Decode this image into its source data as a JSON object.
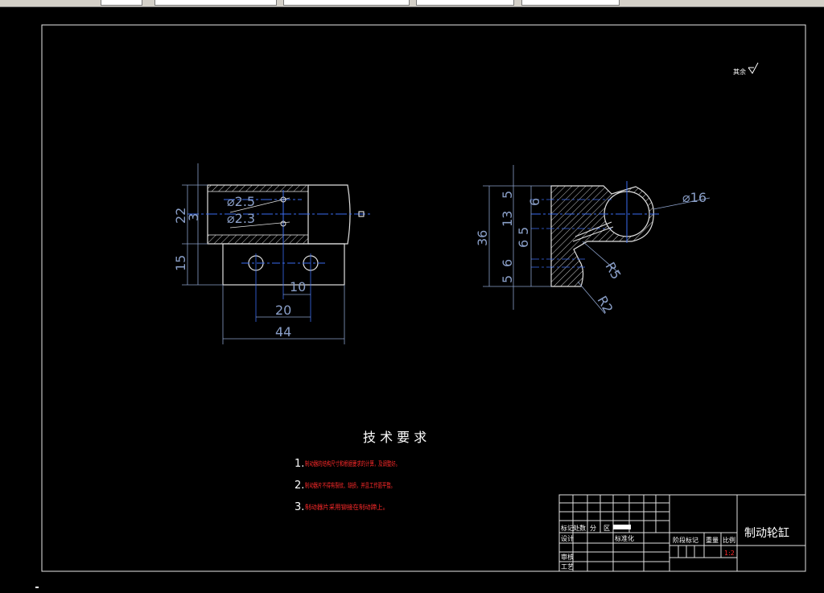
{
  "drawing": {
    "left_view": {
      "dims": {
        "d25": "⌀2.5",
        "d23": "⌀2.3",
        "h22": "22",
        "h3": "3",
        "h15": "15",
        "w10": "10",
        "w20": "20",
        "w44": "44"
      }
    },
    "right_view": {
      "dims": {
        "d16": "⌀16",
        "v5a": "5",
        "v6a": "6",
        "v13": "13",
        "v5b": "5",
        "v36": "36",
        "v6b": "6",
        "v6c": "6",
        "v5c": "5",
        "r5": "R5",
        "r2": "R2"
      }
    },
    "surface_finish": "其余"
  },
  "tech_req": {
    "title": "技 术 要 求",
    "items": [
      {
        "num": "1.",
        "text": "制动器的结构尺寸和根据要求的计算，及调整好。"
      },
      {
        "num": "2.",
        "text": "制动器片不得有裂纹、缺损，并且工作面平整。"
      },
      {
        "num": "3.",
        "text": "制动器片采用铆接在制动蹄上。"
      }
    ]
  },
  "title_block": {
    "part_name": "制动轮缸",
    "scale_value": "1:2",
    "labels": {
      "mark": "标记",
      "count": "处数",
      "zone": "分",
      "zone2": "区",
      "design": "设计",
      "standardize": "标准化",
      "stage_mark": "阶段标记",
      "weight": "重量",
      "scale": "比例",
      "review": "审核",
      "process": "工艺"
    }
  }
}
